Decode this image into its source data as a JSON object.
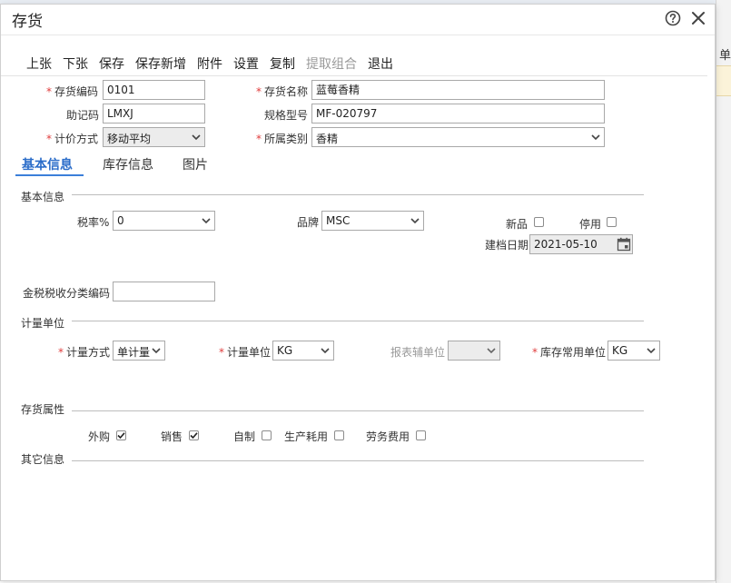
{
  "dialog": {
    "title": "存货"
  },
  "toolbar": {
    "items": [
      {
        "label": "上张",
        "enabled": true
      },
      {
        "label": "下张",
        "enabled": true
      },
      {
        "label": "保存",
        "enabled": true
      },
      {
        "label": "保存新增",
        "enabled": true
      },
      {
        "label": "附件",
        "enabled": true
      },
      {
        "label": "设置",
        "enabled": true
      },
      {
        "label": "复制",
        "enabled": true
      },
      {
        "label": "提取组合",
        "enabled": false
      },
      {
        "label": "退出",
        "enabled": true
      }
    ]
  },
  "header_fields": {
    "code": {
      "label": "存货编码",
      "value": "0101",
      "required": true
    },
    "name": {
      "label": "存货名称",
      "value": "蓝莓香精",
      "required": true
    },
    "mnemonic": {
      "label": "助记码",
      "value": "LMXJ"
    },
    "spec": {
      "label": "规格型号",
      "value": "MF-020797"
    },
    "pricing": {
      "label": "计价方式",
      "value": "移动平均",
      "required": true
    },
    "category": {
      "label": "所属类别",
      "value": "香精",
      "required": true
    }
  },
  "tabs": [
    {
      "label": "基本信息",
      "active": true
    },
    {
      "label": "库存信息",
      "active": false
    },
    {
      "label": "图片",
      "active": false
    }
  ],
  "basic": {
    "section_title": "基本信息",
    "tax_rate": {
      "label": "税率%",
      "value": "0"
    },
    "brand": {
      "label": "品牌",
      "value": "MSC"
    },
    "new_item": {
      "label": "新品",
      "checked": false
    },
    "disabled": {
      "label": "停用",
      "checked": false
    },
    "created_date": {
      "label": "建档日期",
      "value": "2021-05-10"
    },
    "tax_code": {
      "label": "金税税收分类编码",
      "value": ""
    }
  },
  "units": {
    "section_title": "计量单位",
    "method": {
      "label": "计量方式",
      "value": "单计量"
    },
    "unit": {
      "label": "计量单位",
      "value": "KG"
    },
    "report_unit": {
      "label": "报表辅单位",
      "value": ""
    },
    "stock_unit": {
      "label": "库存常用单位",
      "value": "KG"
    }
  },
  "attributes": {
    "section_title": "存货属性",
    "items": [
      {
        "label": "外购",
        "checked": true
      },
      {
        "label": "销售",
        "checked": true
      },
      {
        "label": "自制",
        "checked": false
      },
      {
        "label": "生产耗用",
        "checked": false
      },
      {
        "label": "劳务费用",
        "checked": false
      }
    ]
  },
  "other": {
    "section_title": "其它信息"
  },
  "background": {
    "column_header": "单"
  },
  "colors": {
    "accent": "#3b7fd9",
    "required": "#e03c3c",
    "band": "#fbf3d9"
  }
}
